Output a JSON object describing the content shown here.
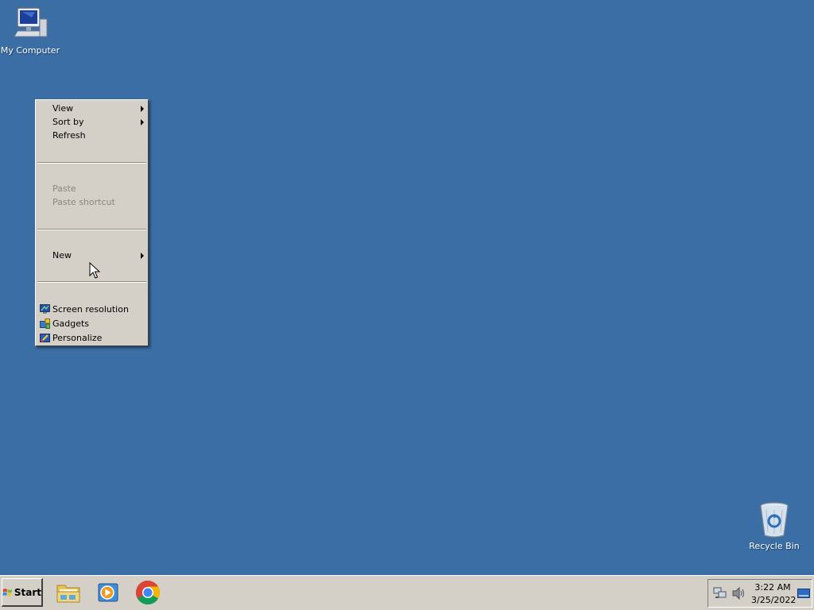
{
  "desktop": {
    "icons": [
      {
        "label": "My Computer",
        "icon": "my-computer-icon"
      },
      {
        "label": "Recycle Bin",
        "icon": "recycle-bin-icon"
      }
    ]
  },
  "context_menu": {
    "items": [
      {
        "label": "View",
        "submenu": true,
        "enabled": true
      },
      {
        "label": "Sort by",
        "submenu": true,
        "enabled": true
      },
      {
        "label": "Refresh",
        "enabled": true
      },
      {
        "label": "Paste",
        "enabled": false
      },
      {
        "label": "Paste shortcut",
        "enabled": false
      },
      {
        "label": "New",
        "submenu": true,
        "enabled": true
      },
      {
        "label": "Screen resolution",
        "icon": "screen-resolution-icon",
        "enabled": true
      },
      {
        "label": "Gadgets",
        "icon": "gadgets-icon",
        "enabled": true
      },
      {
        "label": "Personalize",
        "icon": "personalize-icon",
        "enabled": true
      }
    ]
  },
  "taskbar": {
    "start_label": "Start",
    "pinned": [
      {
        "icon": "file-explorer-icon"
      },
      {
        "icon": "media-player-icon"
      },
      {
        "icon": "chrome-icon"
      }
    ],
    "tray": {
      "icons": [
        "network-icon",
        "volume-icon"
      ],
      "time": "3:22 AM",
      "date": "3/25/2022"
    }
  },
  "colors": {
    "desktop_background": "#3a6ea5",
    "menu_background": "#d4d0c8",
    "taskbar_background": "#d4d0c8"
  }
}
